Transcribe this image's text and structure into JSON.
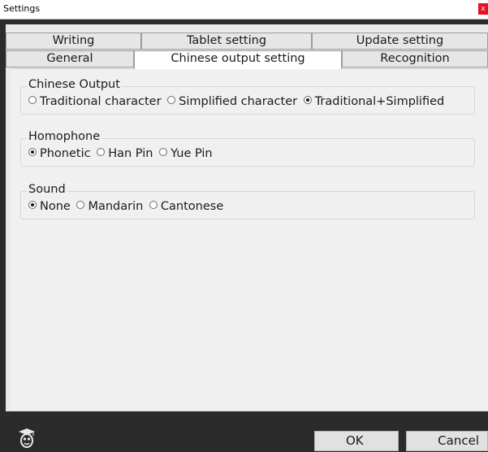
{
  "window": {
    "title": "Settings",
    "close_glyph": "x"
  },
  "tabs": {
    "row1": [
      "Writing",
      "Tablet setting",
      "Update setting"
    ],
    "row2": [
      "General",
      "Chinese output setting",
      "Recognition"
    ],
    "active": "Chinese output setting"
  },
  "groups": {
    "chinese_output": {
      "label": "Chinese Output",
      "options": [
        "Traditional character",
        "Simplified character",
        "Traditional+Simplified"
      ],
      "selected": "Traditional+Simplified"
    },
    "homophone": {
      "label": "Homophone",
      "options": [
        "Phonetic",
        "Han Pin",
        "Yue Pin"
      ],
      "selected": "Phonetic"
    },
    "sound": {
      "label": "Sound",
      "options": [
        "None",
        "Mandarin",
        "Cantonese"
      ],
      "selected": "None"
    }
  },
  "footer": {
    "logo_icon": "mascot-logo-icon",
    "ok_label": "OK",
    "cancel_label": "Cancel"
  }
}
